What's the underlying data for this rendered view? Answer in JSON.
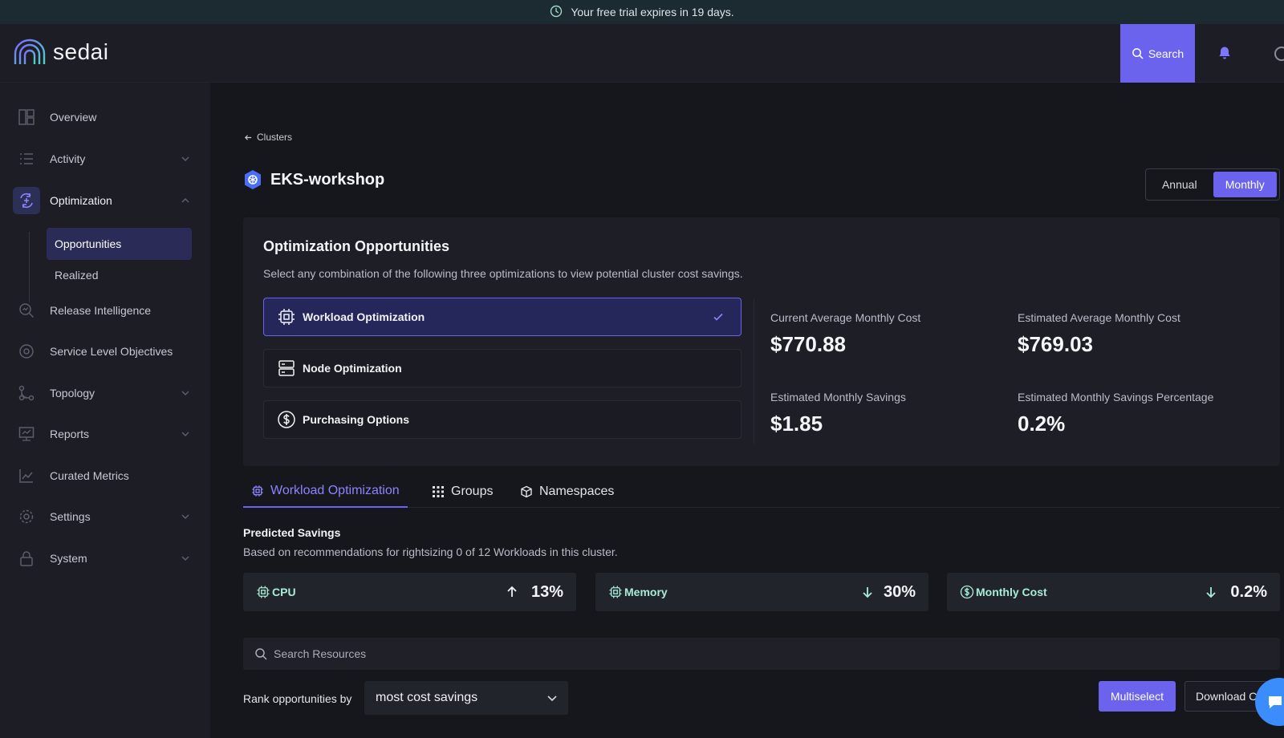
{
  "banner": {
    "text": "Your free trial expires in 19 days."
  },
  "brand": {
    "name": "sedai",
    "accent": "#6b63ee"
  },
  "topbar": {
    "search_label": "Search"
  },
  "sidebar": {
    "items": [
      {
        "label": "Overview"
      },
      {
        "label": "Activity"
      },
      {
        "label": "Optimization"
      },
      {
        "label": "Release Intelligence"
      },
      {
        "label": "Service Level Objectives"
      },
      {
        "label": "Topology"
      },
      {
        "label": "Reports"
      },
      {
        "label": "Curated Metrics"
      },
      {
        "label": "Settings"
      },
      {
        "label": "System"
      }
    ],
    "subitems": [
      {
        "label": "Opportunities"
      },
      {
        "label": "Realized"
      }
    ]
  },
  "page": {
    "breadcrumb": "Clusters",
    "title": "EKS-workshop",
    "period_toggle": {
      "annual": "Annual",
      "monthly": "Monthly",
      "selected": "Monthly"
    }
  },
  "opportunities": {
    "title": "Optimization Opportunities",
    "description": "Select any combination of the following three optimizations to view potential cluster cost savings.",
    "options": [
      {
        "label": "Workload Optimization",
        "selected": true
      },
      {
        "label": "Node Optimization",
        "selected": false
      },
      {
        "label": "Purchasing Options",
        "selected": false
      }
    ],
    "metrics": [
      {
        "label": "Current Average Monthly Cost",
        "value": "$770.88"
      },
      {
        "label": "Estimated Average Monthly Cost",
        "value": "$769.03"
      },
      {
        "label": "Estimated Monthly Savings",
        "value": "$1.85"
      },
      {
        "label": "Estimated Monthly Savings Percentage",
        "value": "0.2%"
      }
    ]
  },
  "tabs": [
    {
      "label": "Workload Optimization",
      "active": true
    },
    {
      "label": "Groups",
      "active": false
    },
    {
      "label": "Namespaces",
      "active": false
    }
  ],
  "predicted_savings": {
    "title": "Predicted Savings",
    "description": "Based on recommendations for rightsizing 0 of 12 Workloads in this cluster.",
    "cards": [
      {
        "label": "CPU",
        "direction": "up",
        "value": "13%"
      },
      {
        "label": "Memory",
        "direction": "down",
        "value": "30%"
      },
      {
        "label": "Monthly Cost",
        "direction": "down",
        "value": "0.2%"
      }
    ]
  },
  "resources": {
    "search_placeholder": "Search Resources",
    "rank_label": "Rank opportunities by",
    "rank_value": "most cost savings",
    "multiselect_label": "Multiselect",
    "download_label": "Download CSV"
  }
}
